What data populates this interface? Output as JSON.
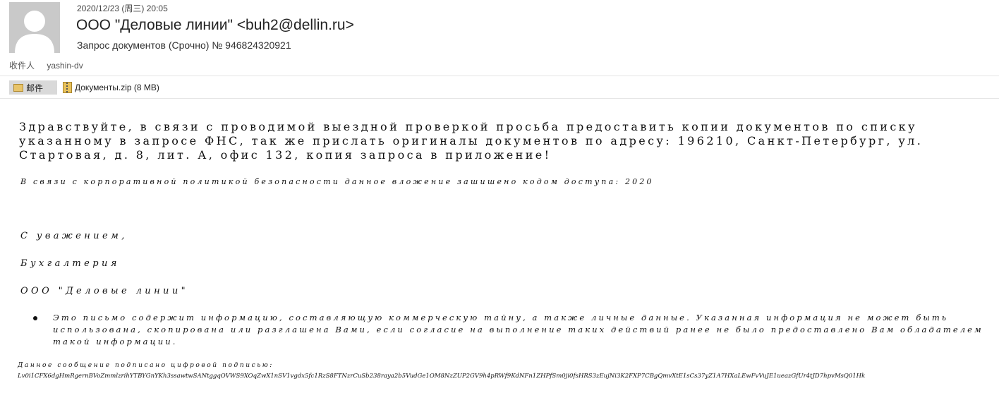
{
  "header": {
    "date": "2020/12/23 (周三) 20:05",
    "sender": "ООО \"Деловые линии\" <buh2@dellin.ru>",
    "subject": "Запрос документов (Срочно) № 946824320921",
    "to_label": "收件人",
    "to_value": "yashin-dv"
  },
  "attachments": {
    "mail_tab_label": "邮件",
    "file_label": "Документы.zip (8 MB)"
  },
  "body": {
    "paragraph": "Здравствуйте, в связи с проводимой выездной проверкой просьба предоставить копии документов по списку указанному в запросе ФНС, так же прислать оригиналы документов по адресу: 196210, Санкт-Петербург, ул. Стартовая, д. 8, лит. А, офис 132, копия запроса в приложение!",
    "note": "В связи с корпоративной политикой безопасности данное вложение зашишено кодом доступа: 2020",
    "signature_1": "С уважением,",
    "signature_2": "Бухгалтерия",
    "signature_3": "ООО \"Деловые линии\"",
    "disclaimer": "Это письмо содержит информацию, составляющую коммерческую тайну, а также личные данные. Указанная информация не может быть использована, скопирована или разглашена Вами, если согласие на выполнение таких действий ранее не было предоставлено Вам обладателем такой информации.",
    "sign_label": "Данное сообщение подписано цифровой подписью:",
    "sign_hash": "Lv0i1CFX6dgHmRgernBVoZmmlzrihYTBYGnYKh3ssawtwSANtggqOVWS9XOqZwX1nSV1vgdx5fc1RzS8FTNzrCuSb238raya2b5VudGe1OM8NzZUP2GV9h4pRWf9KdNFn1ZHPfSm0ji0fsHRS3zEujNi3K2FXP7CBgQmvXtE1sCs37yZ1A7HXaLEwFvVuJE1ueazGfUr4tJD7hpvMsQ01Hk"
  }
}
